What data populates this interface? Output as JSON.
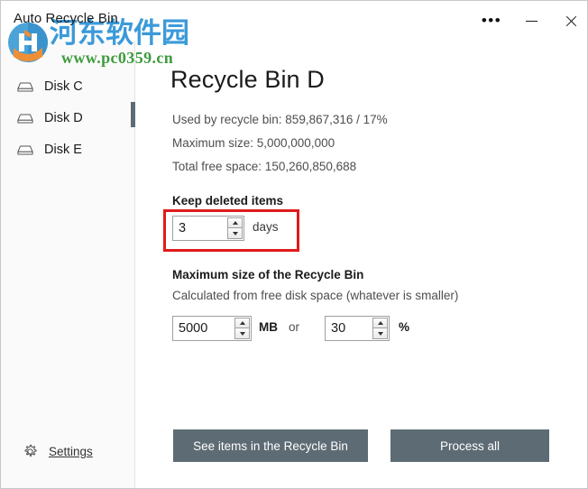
{
  "window": {
    "title": "Auto Recycle Bin",
    "controls": {
      "more_label": "•••",
      "more_name": "more-options",
      "minimize_name": "minimize",
      "close_name": "close"
    }
  },
  "watermark": {
    "text_cn": "河东软件园",
    "url": "www.pc0359.cn",
    "color_cn": "#3b9ad9",
    "color_url": "#3f9b3f"
  },
  "sidebar": {
    "items": [
      {
        "label": "Disk C",
        "icon": "drive-icon",
        "selected": false
      },
      {
        "label": "Disk D",
        "icon": "drive-icon",
        "selected": true
      },
      {
        "label": "Disk E",
        "icon": "drive-icon",
        "selected": false
      }
    ],
    "settings": {
      "label": "Settings",
      "icon": "gear-icon"
    },
    "selection_color": "#5d6b74"
  },
  "main": {
    "title": "Recycle Bin D",
    "stats": {
      "used": "Used by recycle bin: 859,867,316 / 17%",
      "maximum": "Maximum size: 5,000,000,000",
      "free": "Total free space: 150,260,850,688"
    },
    "keep_deleted": {
      "heading": "Keep deleted items",
      "value": "3",
      "unit": "days"
    },
    "maximum_size": {
      "heading": "Maximum size of the Recycle Bin",
      "subtext": "Calculated from free disk space (whatever is smaller)",
      "mb_value": "5000",
      "mb_unit": "MB",
      "conjunction": "or",
      "pct_value": "30",
      "pct_unit": "%"
    },
    "buttons": {
      "see_items": "See items in the Recycle Bin",
      "process_all": "Process all",
      "color": "#5d6b74"
    }
  },
  "annotation": {
    "color": "#e01b1b",
    "target": "keep-deleted-items-spinner"
  }
}
